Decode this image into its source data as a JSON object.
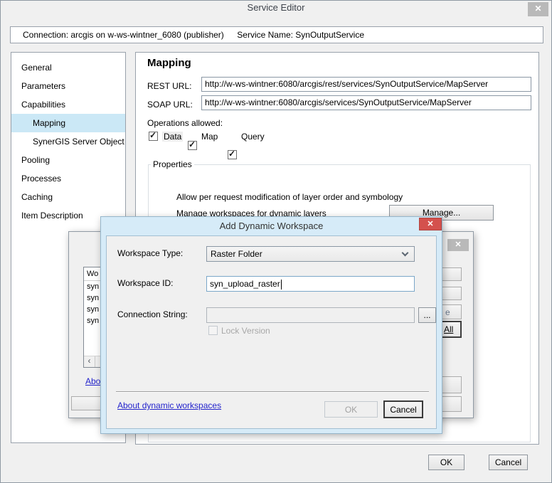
{
  "glyphs": {
    "close": "✕",
    "check": "✓",
    "scroll_left": "‹"
  },
  "window": {
    "title": "Service Editor"
  },
  "connection_bar": {
    "connection": "Connection: arcgis on w-ws-wintner_6080 (publisher)",
    "service": "Service Name: SynOutputService"
  },
  "sidebar": {
    "items": [
      {
        "label": "General"
      },
      {
        "label": "Parameters"
      },
      {
        "label": "Capabilities"
      },
      {
        "label": "Mapping"
      },
      {
        "label": "SynerGIS Server Object E"
      },
      {
        "label": "Pooling"
      },
      {
        "label": "Processes"
      },
      {
        "label": "Caching"
      },
      {
        "label": "Item Description"
      }
    ]
  },
  "mapping_panel": {
    "heading": "Mapping",
    "rest_url_label": "REST URL:",
    "rest_url_value": "http://w-ws-wintner:6080/arcgis/rest/services/SynOutputService/MapServer",
    "soap_url_label": "SOAP URL:",
    "soap_url_value": "http://w-ws-wintner:6080/arcgis/services/SynOutputService/MapServer",
    "operations_label": "Operations allowed:",
    "operations": [
      {
        "label": "Data",
        "checked": true
      },
      {
        "label": "Map",
        "checked": true
      },
      {
        "label": "Query",
        "checked": true
      }
    ],
    "properties_group_label": "Properties",
    "allow_modification_label": "Allow per request modification of layer order and symbology",
    "manage_workspaces_label": "Manage workspaces for dynamic layers",
    "manage_button_label": "Manage..."
  },
  "manage_dialog": {
    "list_header_fragment": "Wo",
    "list_rows_fragments": [
      "syn",
      "syn",
      "syn",
      "syn"
    ],
    "about_link_fragment": "Abou",
    "button_fragment_e": "e",
    "button_fragment_all": "All"
  },
  "add_dialog": {
    "title": "Add Dynamic Workspace",
    "workspace_type_label": "Workspace Type:",
    "workspace_type_value": "Raster Folder",
    "workspace_id_label": "Workspace ID:",
    "workspace_id_value": "syn_upload_raster",
    "connection_string_label": "Connection String:",
    "connection_string_value": "",
    "browse_button_label": "...",
    "lock_version_label": "Lock Version",
    "about_link": "About dynamic workspaces",
    "ok_label": "OK",
    "cancel_label": "Cancel"
  },
  "footer": {
    "ok_label": "OK",
    "cancel_label": "Cancel"
  },
  "colors": {
    "selection_blue": "#cbe8f6",
    "dialog_frame_blue": "#d6ebf8",
    "close_red": "#d4514d",
    "link_blue": "#2323cc"
  }
}
